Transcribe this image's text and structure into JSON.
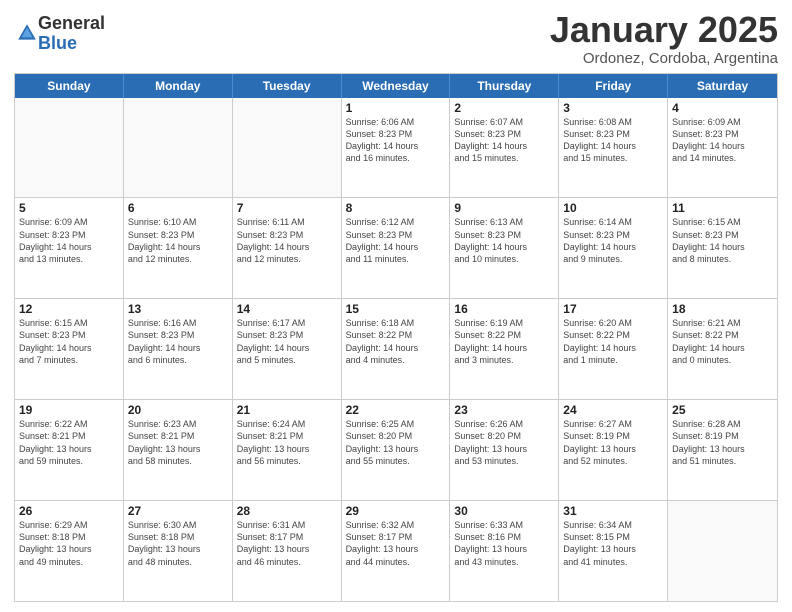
{
  "logo": {
    "general": "General",
    "blue": "Blue"
  },
  "title": {
    "month_year": "January 2025",
    "location": "Ordonez, Cordoba, Argentina"
  },
  "headers": [
    "Sunday",
    "Monday",
    "Tuesday",
    "Wednesday",
    "Thursday",
    "Friday",
    "Saturday"
  ],
  "rows": [
    [
      {
        "day": "",
        "info": ""
      },
      {
        "day": "",
        "info": ""
      },
      {
        "day": "",
        "info": ""
      },
      {
        "day": "1",
        "info": "Sunrise: 6:06 AM\nSunset: 8:23 PM\nDaylight: 14 hours\nand 16 minutes."
      },
      {
        "day": "2",
        "info": "Sunrise: 6:07 AM\nSunset: 8:23 PM\nDaylight: 14 hours\nand 15 minutes."
      },
      {
        "day": "3",
        "info": "Sunrise: 6:08 AM\nSunset: 8:23 PM\nDaylight: 14 hours\nand 15 minutes."
      },
      {
        "day": "4",
        "info": "Sunrise: 6:09 AM\nSunset: 8:23 PM\nDaylight: 14 hours\nand 14 minutes."
      }
    ],
    [
      {
        "day": "5",
        "info": "Sunrise: 6:09 AM\nSunset: 8:23 PM\nDaylight: 14 hours\nand 13 minutes."
      },
      {
        "day": "6",
        "info": "Sunrise: 6:10 AM\nSunset: 8:23 PM\nDaylight: 14 hours\nand 12 minutes."
      },
      {
        "day": "7",
        "info": "Sunrise: 6:11 AM\nSunset: 8:23 PM\nDaylight: 14 hours\nand 12 minutes."
      },
      {
        "day": "8",
        "info": "Sunrise: 6:12 AM\nSunset: 8:23 PM\nDaylight: 14 hours\nand 11 minutes."
      },
      {
        "day": "9",
        "info": "Sunrise: 6:13 AM\nSunset: 8:23 PM\nDaylight: 14 hours\nand 10 minutes."
      },
      {
        "day": "10",
        "info": "Sunrise: 6:14 AM\nSunset: 8:23 PM\nDaylight: 14 hours\nand 9 minutes."
      },
      {
        "day": "11",
        "info": "Sunrise: 6:15 AM\nSunset: 8:23 PM\nDaylight: 14 hours\nand 8 minutes."
      }
    ],
    [
      {
        "day": "12",
        "info": "Sunrise: 6:15 AM\nSunset: 8:23 PM\nDaylight: 14 hours\nand 7 minutes."
      },
      {
        "day": "13",
        "info": "Sunrise: 6:16 AM\nSunset: 8:23 PM\nDaylight: 14 hours\nand 6 minutes."
      },
      {
        "day": "14",
        "info": "Sunrise: 6:17 AM\nSunset: 8:23 PM\nDaylight: 14 hours\nand 5 minutes."
      },
      {
        "day": "15",
        "info": "Sunrise: 6:18 AM\nSunset: 8:22 PM\nDaylight: 14 hours\nand 4 minutes."
      },
      {
        "day": "16",
        "info": "Sunrise: 6:19 AM\nSunset: 8:22 PM\nDaylight: 14 hours\nand 3 minutes."
      },
      {
        "day": "17",
        "info": "Sunrise: 6:20 AM\nSunset: 8:22 PM\nDaylight: 14 hours\nand 1 minute."
      },
      {
        "day": "18",
        "info": "Sunrise: 6:21 AM\nSunset: 8:22 PM\nDaylight: 14 hours\nand 0 minutes."
      }
    ],
    [
      {
        "day": "19",
        "info": "Sunrise: 6:22 AM\nSunset: 8:21 PM\nDaylight: 13 hours\nand 59 minutes."
      },
      {
        "day": "20",
        "info": "Sunrise: 6:23 AM\nSunset: 8:21 PM\nDaylight: 13 hours\nand 58 minutes."
      },
      {
        "day": "21",
        "info": "Sunrise: 6:24 AM\nSunset: 8:21 PM\nDaylight: 13 hours\nand 56 minutes."
      },
      {
        "day": "22",
        "info": "Sunrise: 6:25 AM\nSunset: 8:20 PM\nDaylight: 13 hours\nand 55 minutes."
      },
      {
        "day": "23",
        "info": "Sunrise: 6:26 AM\nSunset: 8:20 PM\nDaylight: 13 hours\nand 53 minutes."
      },
      {
        "day": "24",
        "info": "Sunrise: 6:27 AM\nSunset: 8:19 PM\nDaylight: 13 hours\nand 52 minutes."
      },
      {
        "day": "25",
        "info": "Sunrise: 6:28 AM\nSunset: 8:19 PM\nDaylight: 13 hours\nand 51 minutes."
      }
    ],
    [
      {
        "day": "26",
        "info": "Sunrise: 6:29 AM\nSunset: 8:18 PM\nDaylight: 13 hours\nand 49 minutes."
      },
      {
        "day": "27",
        "info": "Sunrise: 6:30 AM\nSunset: 8:18 PM\nDaylight: 13 hours\nand 48 minutes."
      },
      {
        "day": "28",
        "info": "Sunrise: 6:31 AM\nSunset: 8:17 PM\nDaylight: 13 hours\nand 46 minutes."
      },
      {
        "day": "29",
        "info": "Sunrise: 6:32 AM\nSunset: 8:17 PM\nDaylight: 13 hours\nand 44 minutes."
      },
      {
        "day": "30",
        "info": "Sunrise: 6:33 AM\nSunset: 8:16 PM\nDaylight: 13 hours\nand 43 minutes."
      },
      {
        "day": "31",
        "info": "Sunrise: 6:34 AM\nSunset: 8:15 PM\nDaylight: 13 hours\nand 41 minutes."
      },
      {
        "day": "",
        "info": ""
      }
    ]
  ]
}
